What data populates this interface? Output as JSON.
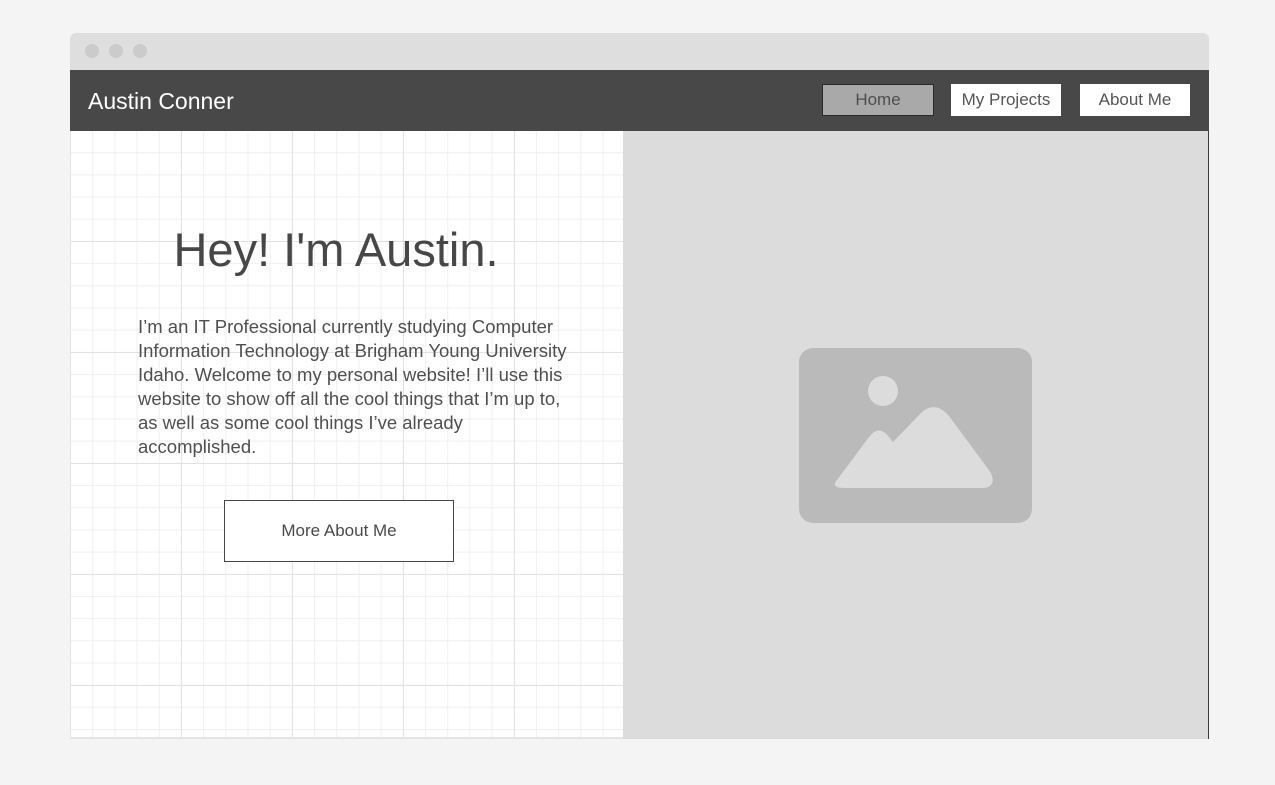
{
  "titlebar": {
    "dots": [
      "window-dot-1",
      "window-dot-2",
      "window-dot-3"
    ]
  },
  "navbar": {
    "brand": "Austin Conner",
    "links": [
      {
        "label": "Home",
        "active": true
      },
      {
        "label": "My Projects",
        "active": false
      },
      {
        "label": "About Me",
        "active": false
      }
    ]
  },
  "hero": {
    "title": "Hey! I'm Austin.",
    "text": "I’m an IT Professional currently studying Computer Information Technology at Brigham Young University Idaho. Welcome to my personal website! I’ll use this website to show off all the cool things that I’m up to, as well as some cool things I’ve already accomplished.",
    "button_label": "More About Me"
  },
  "image": {
    "icon": "image-placeholder-icon"
  },
  "colors": {
    "navbar_bg": "#484848",
    "active_nav_bg": "#a9a9a9",
    "placeholder_bg": "#dcdcdc",
    "placeholder_icon": "#bababa"
  }
}
